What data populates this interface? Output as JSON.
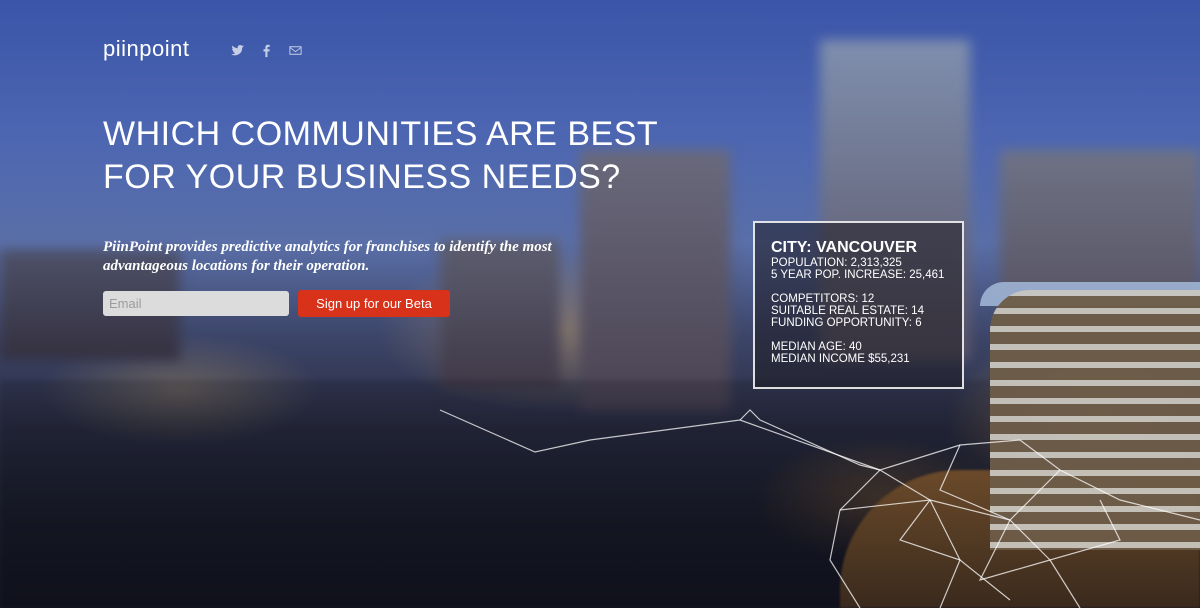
{
  "brand": {
    "logo": "piinpoint"
  },
  "social": [
    {
      "icon": "twitter-icon"
    },
    {
      "icon": "facebook-icon"
    },
    {
      "icon": "email-icon"
    }
  ],
  "hero": {
    "headline_line1": "WHICH COMMUNITIES ARE BEST",
    "headline_line2": "FOR YOUR BUSINESS NEEDS?",
    "tagline": "PiinPoint provides predictive analytics for franchises to identify the most advantageous locations for their operation."
  },
  "signup": {
    "email_placeholder": "Email",
    "email_value": "",
    "button_label": "Sign up for our Beta"
  },
  "infobox": {
    "city": "CITY: VANCOUVER",
    "population": "POPULATION: 2,313,325",
    "pop_increase": "5 YEAR POP. INCREASE: 25,461",
    "competitors": "COMPETITORS: 12",
    "real_estate": "SUITABLE REAL ESTATE: 14",
    "funding": "FUNDING OPPORTUNITY: 6",
    "median_age": "MEDIAN AGE: 40",
    "median_income": "MEDIAN INCOME $55,231"
  },
  "colors": {
    "accent": "#d8321a",
    "sky": "#4c66b2"
  }
}
